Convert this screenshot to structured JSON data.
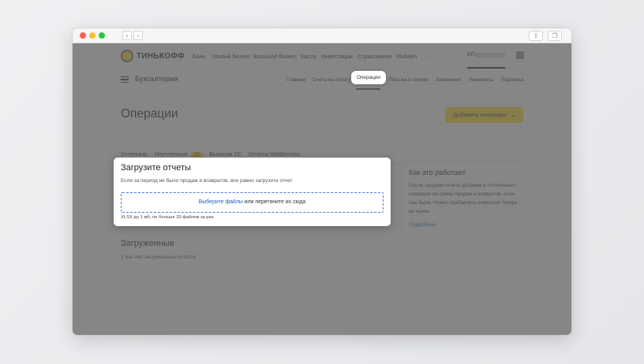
{
  "topnav": {
    "logo_text": "ТИНЬКОФФ",
    "links": [
      "Банк",
      "Малый бизнес",
      "Большой бизнес",
      "Касса",
      "Инвестиции",
      "Страхование",
      "Мобайл",
      "···"
    ],
    "user_label": "ИП"
  },
  "subnav": {
    "title": "Бухгалтерия",
    "links": [
      "Главная",
      "Счета на оплату",
      "Операции",
      "Письма и сверки",
      "Заявления",
      "Реквизиты",
      "Подписка"
    ],
    "active": "Операции"
  },
  "page_title": "Операции",
  "add_button": {
    "label": "Добавить операции",
    "icon": "chevron-down-icon"
  },
  "tabs": [
    {
      "label": "Учтенные"
    },
    {
      "label": "Неучтенные",
      "badge": "12"
    },
    {
      "label": "Выписки 1С"
    },
    {
      "label": "Отчеты Wildberries",
      "active": true
    }
  ],
  "upload": {
    "title": "Загрузите отчеты",
    "description": "Если за период не было продаж и возвратов, все равно загрузите отчет",
    "pick_link": "Выберите файлы",
    "drop_text": " или перетяните их сюда",
    "hint": "XLSX до 1 мб, не больше 20 файлов за раз"
  },
  "info": {
    "title": "Как это работает",
    "text": "После загрузки отчета добавим в «Учтенные» операции на сумму продаж и возвратов, если они были. Нужно прибавлять комиссию теперь не нужно",
    "more_link": "Подробнее"
  },
  "loaded": {
    "title": "Загруженные",
    "empty_text": "У вас нет загруженных отчетов"
  },
  "colors": {
    "accent": "#ffdd2d",
    "link": "#1e5fbf",
    "overlay": "#585858"
  }
}
